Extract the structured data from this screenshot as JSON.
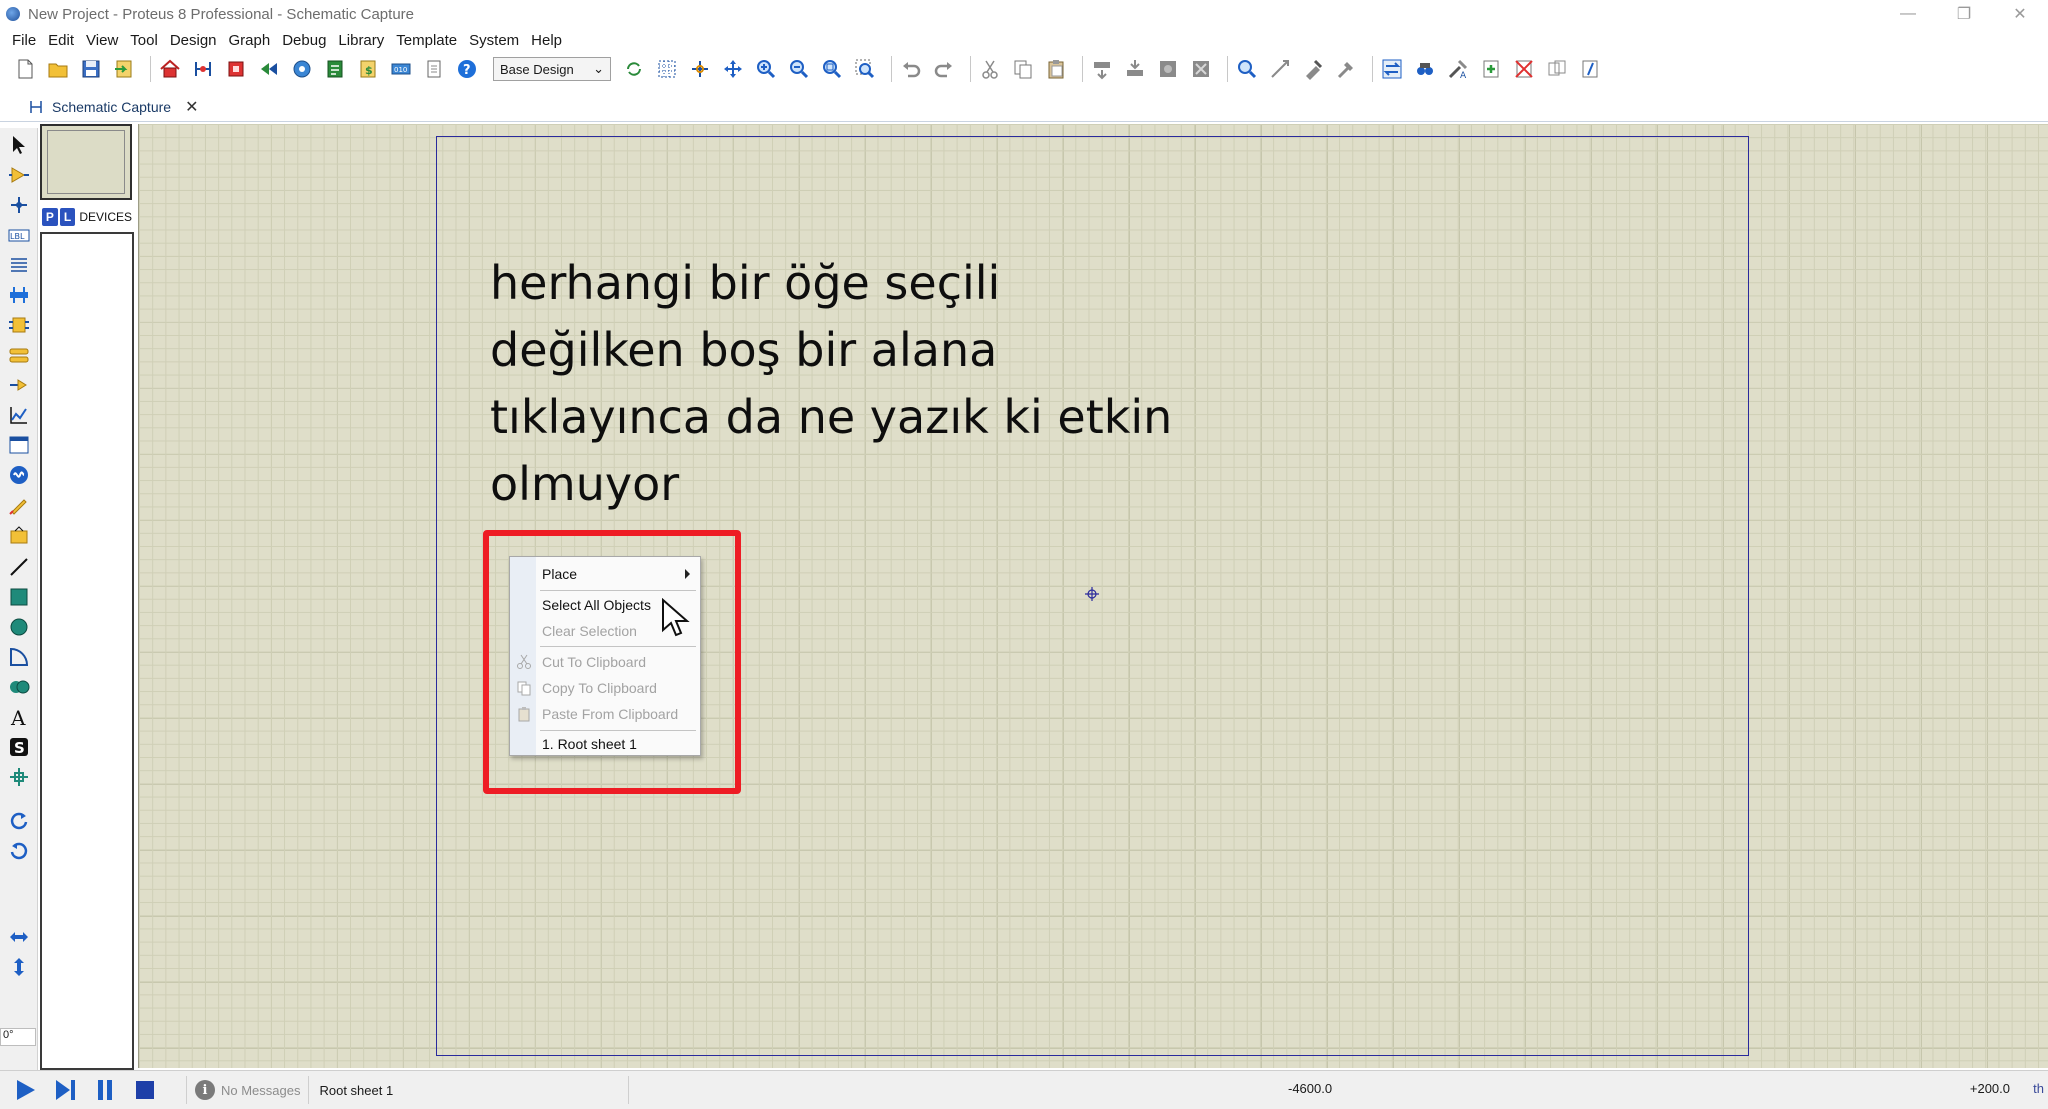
{
  "window": {
    "title": "New Project - Proteus 8 Professional - Schematic Capture",
    "minimize": "—",
    "restore": "❐",
    "close": "✕"
  },
  "menu": [
    "File",
    "Edit",
    "View",
    "Tool",
    "Design",
    "Graph",
    "Debug",
    "Library",
    "Template",
    "System",
    "Help"
  ],
  "toolbar": {
    "design_variant": "Base Design"
  },
  "tab": {
    "label": "Schematic Capture",
    "close": "✕"
  },
  "device_panel": {
    "p_button": "P",
    "l_button": "L",
    "label": "DEVICES"
  },
  "rotation_angle": "0°",
  "annotation": {
    "lines": [
      "herhangi bir öğe seçili",
      "değilken boş bir alana",
      "tıklayınca da ne yazık ki etkin",
      "olmuyor"
    ]
  },
  "context_menu": {
    "items": [
      {
        "label": "Place",
        "disabled": false,
        "submenu": true
      },
      {
        "label": "Select All Objects",
        "disabled": false
      },
      {
        "label": "Clear Selection",
        "disabled": true
      },
      {
        "label": "Cut To Clipboard",
        "disabled": true,
        "icon": "scissors-icon"
      },
      {
        "label": "Copy To Clipboard",
        "disabled": true,
        "icon": "copy-icon"
      },
      {
        "label": "Paste From Clipboard",
        "disabled": true,
        "icon": "paste-icon"
      },
      {
        "label": "1. Root sheet 1",
        "disabled": false
      }
    ]
  },
  "status": {
    "messages": "No Messages",
    "sheet": "Root sheet 1",
    "coord_x": "-4600.0",
    "coord_y": "+200.0",
    "unit": "th"
  },
  "colors": {
    "canvas": "#dfdec9",
    "sheet_border": "#2a2a9c",
    "highlight": "#ee1c24",
    "accent_blue": "#2a52be"
  }
}
